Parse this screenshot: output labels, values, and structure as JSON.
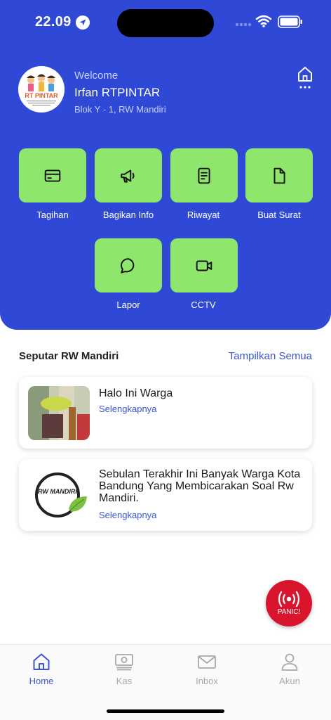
{
  "status_bar": {
    "time": "22.09"
  },
  "profile": {
    "welcome": "Welcome",
    "name": "Irfan RTPINTAR",
    "address": "Blok Y - 1, RW Mandiri",
    "avatar_logo_text": "RT PINTAR"
  },
  "menu": [
    {
      "label": "Tagihan",
      "icon": "card-icon"
    },
    {
      "label": "Bagikan Info",
      "icon": "megaphone-icon"
    },
    {
      "label": "Riwayat",
      "icon": "document-list-icon"
    },
    {
      "label": "Buat Surat",
      "icon": "file-icon"
    },
    {
      "label": "Lapor",
      "icon": "chat-bubble-icon"
    },
    {
      "label": "CCTV",
      "icon": "video-camera-icon"
    }
  ],
  "news": {
    "section_title": "Seputar RW Mandiri",
    "see_all": "Tampilkan Semua",
    "items": [
      {
        "title": "Halo Ini Warga",
        "link": "Selengkapnya"
      },
      {
        "title": "Sebulan Terakhir Ini Banyak Warga Kota Bandung Yang Membicarakan Soal Rw Mandiri.",
        "link": "Selengkapnya",
        "logo_text": "RW MANDIRI"
      }
    ]
  },
  "panic": {
    "label": "PANIC!"
  },
  "tabbar": {
    "items": [
      {
        "label": "Home",
        "icon": "home-icon",
        "active": true
      },
      {
        "label": "Kas",
        "icon": "money-icon",
        "active": false
      },
      {
        "label": "Inbox",
        "icon": "mail-icon",
        "active": false
      },
      {
        "label": "Akun",
        "icon": "person-icon",
        "active": false
      }
    ]
  },
  "colors": {
    "primary": "#2f48d6",
    "menu_button": "#8ee66c",
    "link": "#3a56d4",
    "panic": "#d9152e",
    "tab_inactive": "#a8a8a8"
  }
}
